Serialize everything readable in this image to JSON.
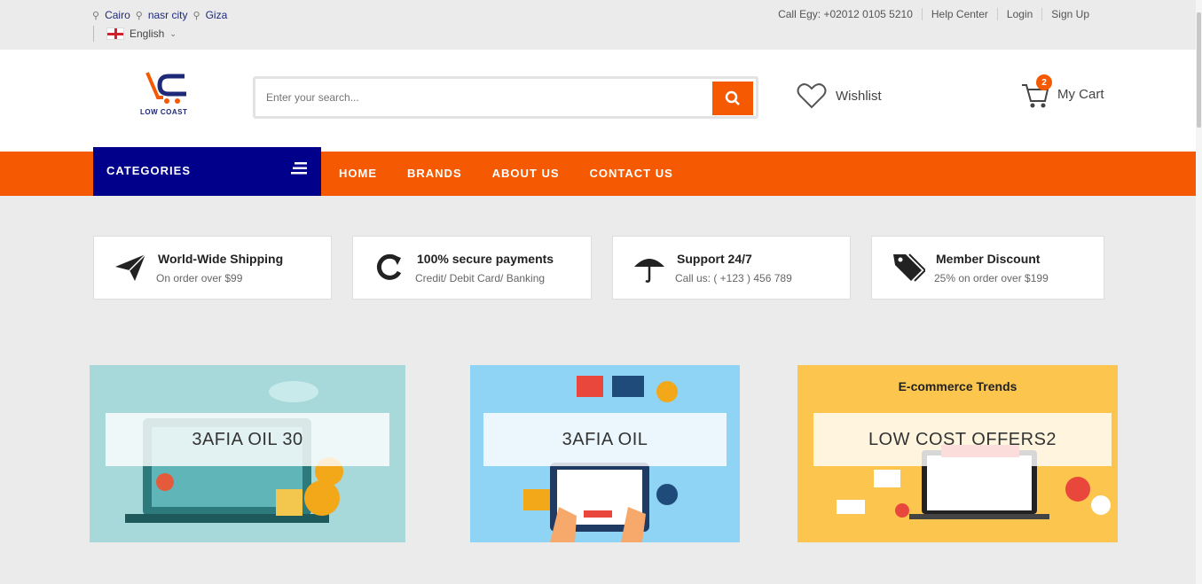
{
  "topbar": {
    "locations": [
      "Cairo",
      "nasr city",
      "Giza"
    ],
    "language": "English",
    "links": [
      "Call Egy: +02012 0105 5210",
      "Help Center",
      "Login",
      "Sign Up"
    ]
  },
  "logo": {
    "text": "LOW COAST"
  },
  "search": {
    "placeholder": "Enter your search..."
  },
  "wishlist": {
    "label": "Wishlist"
  },
  "cart": {
    "label": "My Cart",
    "count": "2"
  },
  "nav": {
    "categories_label": "CATEGORIES",
    "items": [
      "HOME",
      "BRANDS",
      "ABOUT US",
      "CONTACT US"
    ]
  },
  "features": [
    {
      "title": "World-Wide Shipping",
      "subtitle": "On order over $99",
      "icon": "paper-plane-icon"
    },
    {
      "title": "100% secure payments",
      "subtitle": "Credit/ Debit Card/ Banking",
      "icon": "refresh-icon"
    },
    {
      "title": "Support 24/7",
      "subtitle": "Call us: ( +123 ) 456 789",
      "icon": "umbrella-icon"
    },
    {
      "title": "Member Discount",
      "subtitle": "25% on order over $199",
      "icon": "tags-icon"
    }
  ],
  "banners": [
    {
      "label": "3AFIA OIL 30",
      "bg": "#a7d8da"
    },
    {
      "label": "3AFIA OIL",
      "bg": "#8fd3f5"
    },
    {
      "label": "LOW COST OFFERS2",
      "bg": "#fcc54e",
      "heading": "E-commerce Trends"
    }
  ],
  "colors": {
    "accent": "#f55a02",
    "navy": "#00008b"
  }
}
